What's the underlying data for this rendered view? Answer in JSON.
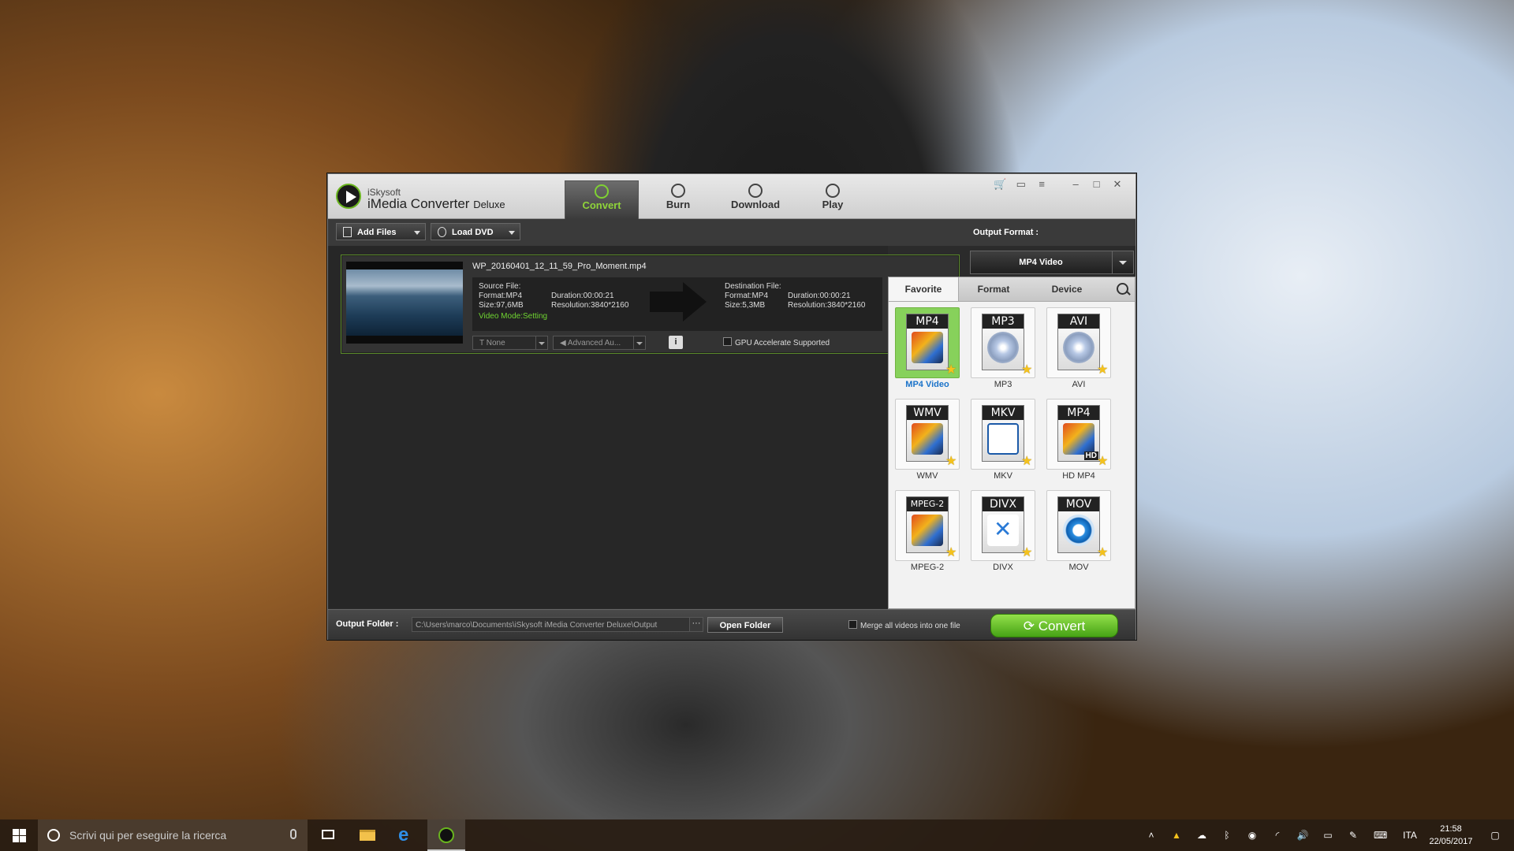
{
  "window": {
    "brand_small": "iSkysoft",
    "brand_main": "iMedia Converter",
    "brand_edition": "Deluxe",
    "tabs": [
      {
        "label": "Convert",
        "icon": "refresh-icon",
        "active": true
      },
      {
        "label": "Burn",
        "icon": "disc-icon",
        "active": false
      },
      {
        "label": "Download",
        "icon": "download-icon",
        "active": false
      },
      {
        "label": "Play",
        "icon": "play-icon",
        "active": false
      }
    ],
    "title_icons": [
      "cart-icon",
      "chat-icon",
      "menu-icon",
      "minimize-icon",
      "maximize-icon",
      "close-icon"
    ]
  },
  "toolbar": {
    "add_files": "Add Files",
    "load_dvd": "Load DVD",
    "output_format_label": "Output Format :",
    "output_format_value": "MP4 Video"
  },
  "file": {
    "name": "WP_20160401_12_11_59_Pro_Moment.mp4",
    "source_label": "Source File:",
    "source_format": "Format:MP4",
    "source_duration": "Duration:00:00:21",
    "source_size": "Size:97,6MB",
    "source_resolution": "Resolution:3840*2160",
    "video_mode": "Video Mode:Setting",
    "dest_label": "Destination File:",
    "dest_format": "Format:MP4",
    "dest_duration": "Duration:00:00:21",
    "dest_size": "Size:5,3MB",
    "dest_resolution": "Resolution:3840*2160",
    "subtitle_value": "None",
    "audio_value": "Advanced Au...",
    "info_label": "i",
    "gpu_label": "GPU Accelerate Supported"
  },
  "panel": {
    "tabs": [
      "Favorite",
      "Format",
      "Device"
    ],
    "formats": [
      {
        "label": "MP4",
        "name": "MP4 Video",
        "art": "film",
        "selected": true
      },
      {
        "label": "MP3",
        "name": "MP3",
        "art": "disc",
        "selected": false
      },
      {
        "label": "AVI",
        "name": "AVI",
        "art": "disc",
        "selected": false
      },
      {
        "label": "WMV",
        "name": "WMV",
        "art": "film",
        "selected": false
      },
      {
        "label": "MKV",
        "name": "MKV",
        "art": "matroska",
        "selected": false
      },
      {
        "label": "MP4",
        "name": "HD MP4",
        "art": "film",
        "selected": false,
        "badge": "HD"
      },
      {
        "label": "MPEG-2",
        "name": "MPEG-2",
        "art": "film",
        "selected": false
      },
      {
        "label": "DIVX",
        "name": "DIVX",
        "art": "divx",
        "selected": false
      },
      {
        "label": "MOV",
        "name": "MOV",
        "art": "mov",
        "selected": false
      }
    ]
  },
  "footer": {
    "output_folder_label": "Output Folder :",
    "output_path": "C:\\Users\\marco\\Documents\\iSkysoft iMedia Converter Deluxe\\Output",
    "browse": "···",
    "open_folder": "Open Folder",
    "merge_label": "Merge all videos into one file",
    "convert": "Convert"
  },
  "taskbar": {
    "search_placeholder": "Scrivi qui per eseguire la ricerca",
    "language": "ITA",
    "time": "21:58",
    "date": "22/05/2017"
  }
}
